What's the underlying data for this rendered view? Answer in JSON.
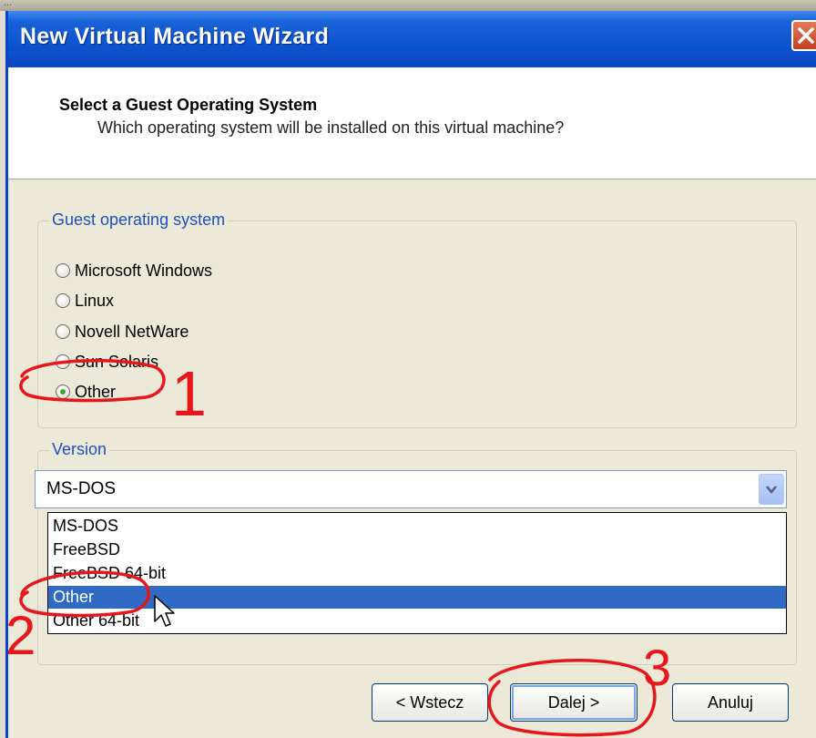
{
  "window": {
    "top_strip_text": "...",
    "title": "New Virtual Machine Wizard"
  },
  "header": {
    "title": "Select a Guest Operating System",
    "subtitle": "Which operating system will be installed on this virtual machine?"
  },
  "guest_os_group": {
    "legend": "Guest operating system",
    "options": [
      {
        "label": "Microsoft Windows",
        "checked": false
      },
      {
        "label": "Linux",
        "checked": false
      },
      {
        "label": "Novell NetWare",
        "checked": false
      },
      {
        "label": "Sun Solaris",
        "checked": false
      },
      {
        "label": "Other",
        "checked": true
      }
    ]
  },
  "version_group": {
    "legend": "Version",
    "selected_value": "MS-DOS",
    "dropdown_items": [
      {
        "label": "MS-DOS",
        "selected": false
      },
      {
        "label": "FreeBSD",
        "selected": false
      },
      {
        "label": "FreeBSD 64-bit",
        "selected": false
      },
      {
        "label": "Other",
        "selected": true
      },
      {
        "label": "Other 64-bit",
        "selected": false
      }
    ]
  },
  "buttons": {
    "back": "< Wstecz",
    "next": "Dalej >",
    "cancel": "Anuluj"
  },
  "annotations": {
    "step1": "1",
    "step2": "2",
    "step3": "3",
    "color": "#e8151b"
  },
  "colors": {
    "titlebar": "#0d54d0",
    "selection": "#316ac5",
    "legend_text": "#1f4fc2"
  }
}
